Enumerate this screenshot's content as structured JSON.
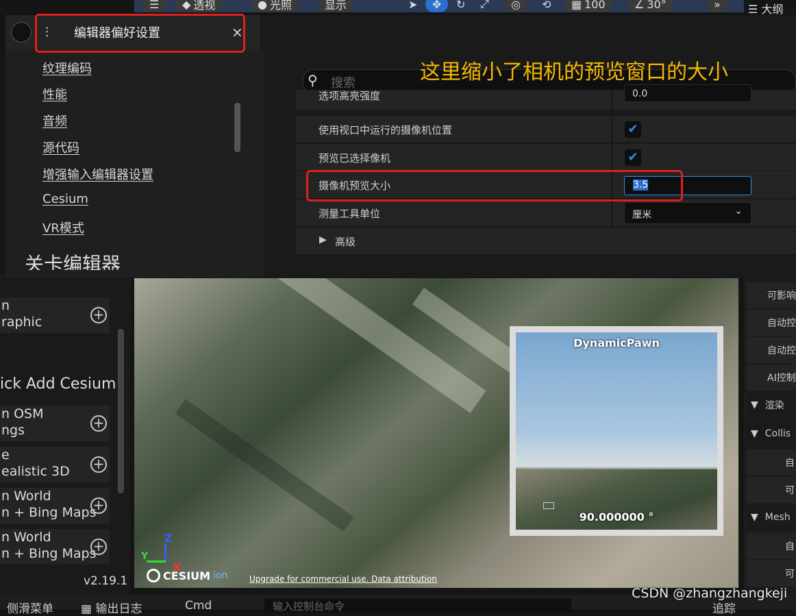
{
  "toolbar": {
    "perspective": "透视",
    "lighting": "光照",
    "show": "显示",
    "zoom": "100",
    "angle": "30°",
    "right_tab": "大纲"
  },
  "dialog": {
    "title": "编辑器偏好设置",
    "close": "×"
  },
  "nav": {
    "items": [
      "纹理编码",
      "性能",
      "音频",
      "源代码",
      "增强输入编辑器设置",
      "Cesium",
      "VR模式"
    ],
    "section_partial": "关卡编辑器"
  },
  "search": {
    "placeholder": "搜索"
  },
  "annotation": "这里缩小了相机的预览窗口的大小",
  "props": {
    "row0": {
      "label": "选项高亮强度",
      "value": "0.0"
    },
    "row1": {
      "label": "使用视口中运行的摄像机位置",
      "checked": true
    },
    "row2": {
      "label": "预览已选择像机",
      "checked": true
    },
    "row3": {
      "label": "摄像机预览大小",
      "value": "3.5"
    },
    "row4": {
      "label": "测量工具单位",
      "value": "厘米"
    },
    "advanced": "高级"
  },
  "cesium_panel": {
    "items": [
      {
        "l1": "n",
        "l2": "raphic"
      },
      {
        "l1": "ick Add Cesium",
        "l2": ""
      },
      {
        "l1": "n OSM",
        "l2": "ngs"
      },
      {
        "l1": "e",
        "l2": "ealistic 3D"
      },
      {
        "l1": "n World",
        "l2": "n + Bing Maps"
      },
      {
        "l1": "n World",
        "l2": "n + Bing Maps"
      }
    ],
    "version": "v2.19.1"
  },
  "viewport": {
    "preview_title": "DynamicPawn",
    "preview_fov": "90.000000 °",
    "cesium_logo": "CESIUM",
    "cesium_ion": "ion",
    "attribution": "Upgrade for commercial use. Data attribution",
    "axis_z": "Z",
    "axis_x": "X",
    "axis_y": "Y"
  },
  "details_right": {
    "items": [
      "可影响",
      "自动控",
      "自动控",
      "AI控制"
    ],
    "sections": [
      "渲染",
      "Collis",
      "Mesh"
    ],
    "sub": [
      "自",
      "可",
      "自",
      "可"
    ]
  },
  "bottom": {
    "b1": "侧滑菜单",
    "b2": "输出日志",
    "b3": "Cmd",
    "b4": "输入控制台命令",
    "b5": "追踪"
  },
  "watermark": "CSDN @zhangzhangkeji"
}
